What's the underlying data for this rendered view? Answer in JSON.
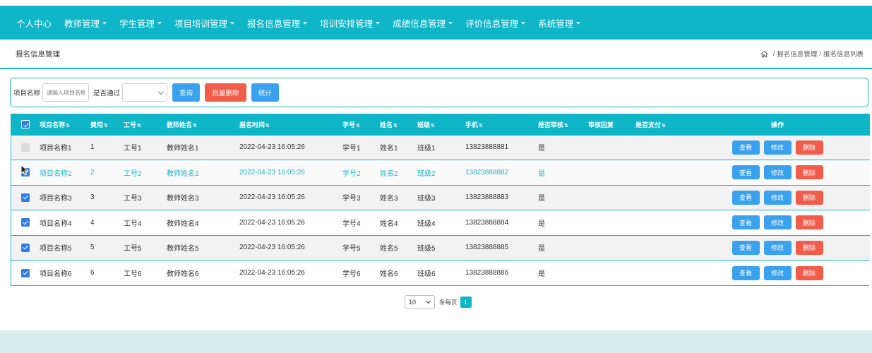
{
  "nav": {
    "items": [
      {
        "label": "个人中心",
        "caret": false
      },
      {
        "label": "教师管理",
        "caret": true
      },
      {
        "label": "学生管理",
        "caret": true
      },
      {
        "label": "项目培训管理",
        "caret": true
      },
      {
        "label": "报名信息管理",
        "caret": true
      },
      {
        "label": "培训安排管理",
        "caret": true
      },
      {
        "label": "成绩信息管理",
        "caret": true
      },
      {
        "label": "评价信息管理",
        "caret": true
      },
      {
        "label": "系统管理",
        "caret": true
      }
    ],
    "color": "#0eb6c8"
  },
  "page": {
    "title": "报名信息管理",
    "breadcrumb": [
      "报名信息管理",
      "报名信息列表"
    ],
    "home_icon": "home-icon"
  },
  "search": {
    "project_label": "项目名称",
    "project_placeholder": "请输入项目名称",
    "passed_label": "是否通过",
    "passed_value": "",
    "query_button": "查询",
    "batch_delete_button": "批量删除",
    "stats_button": "统计"
  },
  "table": {
    "headers": [
      "项目名称",
      "费用",
      "工号",
      "教师姓名",
      "报名时间",
      "学号",
      "姓名",
      "班级",
      "手机",
      "是否审核",
      "审核回复",
      "是否支付",
      "操作"
    ],
    "sortable": [
      true,
      true,
      true,
      true,
      true,
      true,
      true,
      true,
      true,
      true,
      false,
      true,
      false
    ],
    "rows": [
      {
        "checked": false,
        "cells": [
          "项目名称1",
          "1",
          "工号1",
          "教师姓名1",
          "2022-04-23 16:05:26",
          "学号1",
          "姓名1",
          "班级1",
          "13823888881",
          "是",
          "",
          ""
        ]
      },
      {
        "checked": true,
        "hover": true,
        "cells": [
          "项目名称2",
          "2",
          "工号2",
          "教师姓名2",
          "2022-04-23 16:05:26",
          "学号2",
          "姓名2",
          "班级2",
          "13823888882",
          "是",
          "",
          ""
        ]
      },
      {
        "checked": true,
        "cells": [
          "项目名称3",
          "3",
          "工号3",
          "教师姓名3",
          "2022-04-23 16:05:26",
          "学号3",
          "姓名3",
          "班级3",
          "13823888883",
          "是",
          "",
          ""
        ]
      },
      {
        "checked": true,
        "cells": [
          "项目名称4",
          "4",
          "工号4",
          "教师姓名4",
          "2022-04-23 16:05:26",
          "学号4",
          "姓名4",
          "班级4",
          "13823888884",
          "是",
          "",
          ""
        ]
      },
      {
        "checked": true,
        "cells": [
          "项目名称5",
          "5",
          "工号5",
          "教师姓名5",
          "2022-04-23 16:05:26",
          "学号5",
          "姓名5",
          "班级5",
          "13823888885",
          "是",
          "",
          ""
        ]
      },
      {
        "checked": true,
        "cells": [
          "项目名称6",
          "6",
          "工号6",
          "教师姓名6",
          "2022-04-23 16:05:26",
          "学号6",
          "姓名6",
          "班级6",
          "13823888886",
          "是",
          "",
          ""
        ]
      }
    ],
    "actions": {
      "view": "查看",
      "edit": "修改",
      "delete": "删除"
    }
  },
  "pagination": {
    "page_size": "10",
    "page_size_label": "条每页",
    "current_page": "1"
  },
  "colors": {
    "primary": "#0eb6c8",
    "button_blue": "#3aa1ee",
    "button_red": "#f25c4b",
    "checkbox": "#2e7ee6"
  }
}
